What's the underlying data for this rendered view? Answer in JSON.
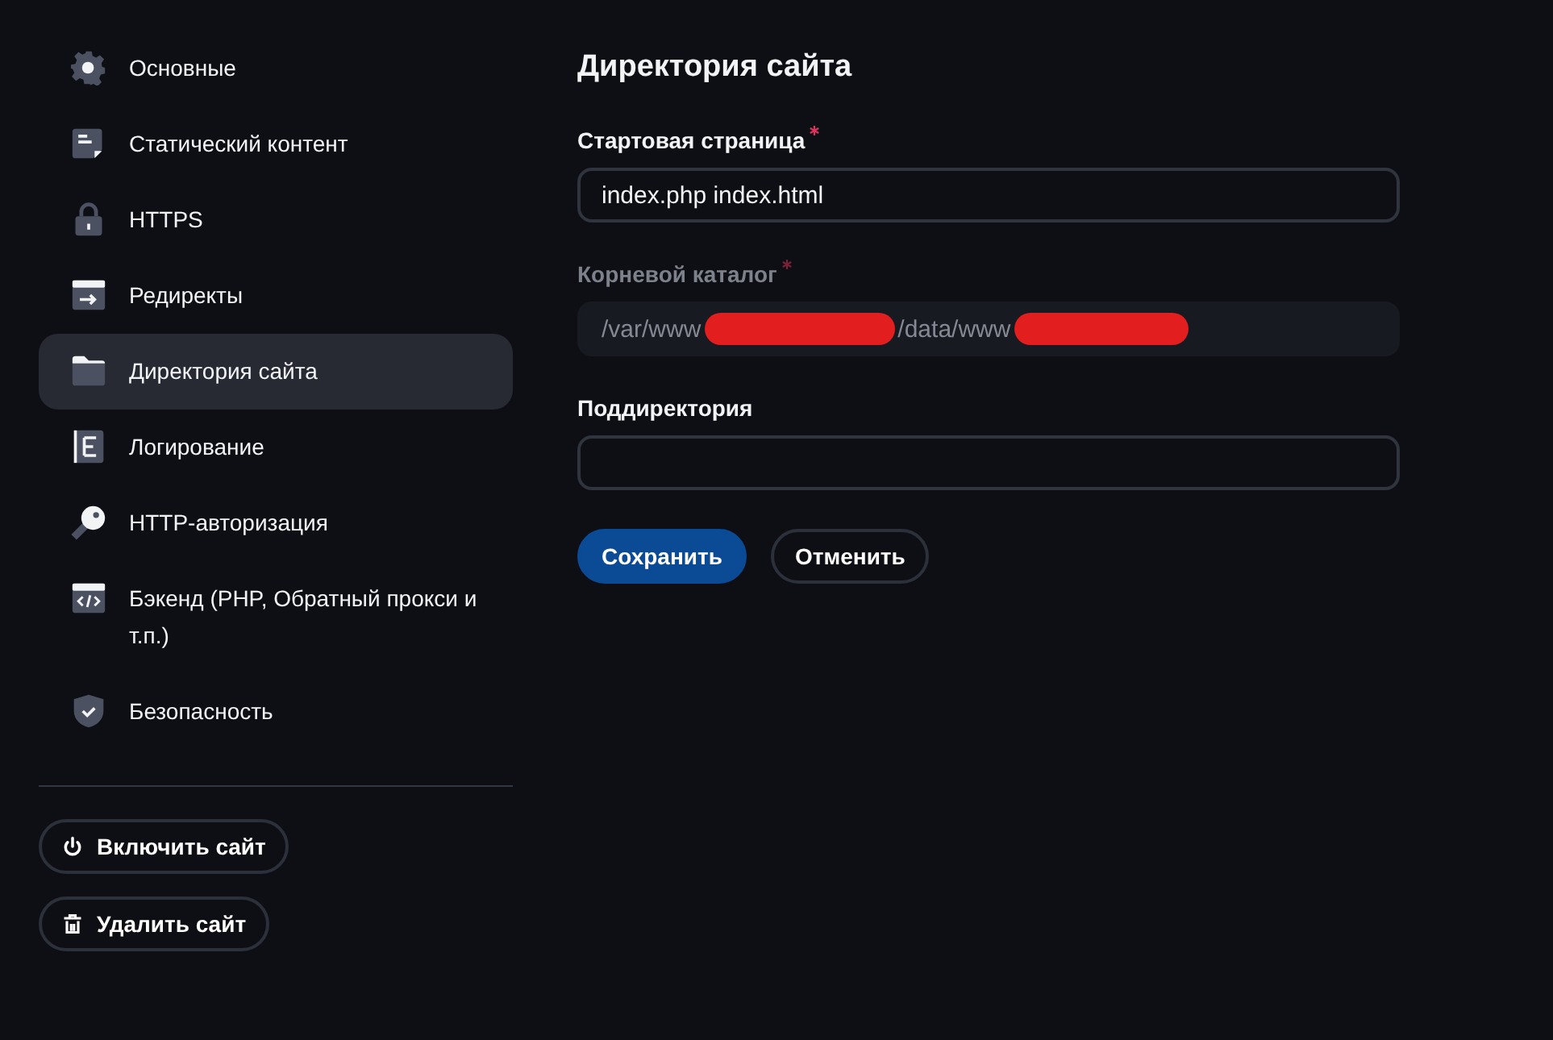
{
  "sidebar": {
    "items": [
      {
        "label": "Основные",
        "selected": false
      },
      {
        "label": "Статический контент",
        "selected": false
      },
      {
        "label": "HTTPS",
        "selected": false
      },
      {
        "label": "Редиректы",
        "selected": false
      },
      {
        "label": "Директория сайта",
        "selected": true
      },
      {
        "label": "Логирование",
        "selected": false
      },
      {
        "label": "HTTP-авторизация",
        "selected": false
      },
      {
        "label": "Бэкенд (PHP, Обратный прокси и т.п.)",
        "selected": false
      },
      {
        "label": "Безопасность",
        "selected": false
      }
    ],
    "actions": [
      {
        "label": "Включить сайт"
      },
      {
        "label": "Удалить сайт"
      }
    ]
  },
  "form": {
    "title": "Директория сайта",
    "fields": [
      {
        "label": "Стартовая страница",
        "required": true,
        "disabled": false,
        "value": "index.php index.html"
      },
      {
        "label": "Корневой каталог",
        "required": true,
        "disabled": true,
        "segments": [
          {
            "kind": "text",
            "text": "/var/www"
          },
          {
            "kind": "redaction"
          },
          {
            "kind": "text",
            "text": "/data/www"
          },
          {
            "kind": "redaction"
          }
        ]
      },
      {
        "label": "Поддиректория",
        "required": false,
        "disabled": false
      }
    ],
    "buttons": [
      {
        "label": "Сохранить",
        "kind": "primary"
      },
      {
        "label": "Отменить",
        "kind": "secondary"
      }
    ]
  }
}
